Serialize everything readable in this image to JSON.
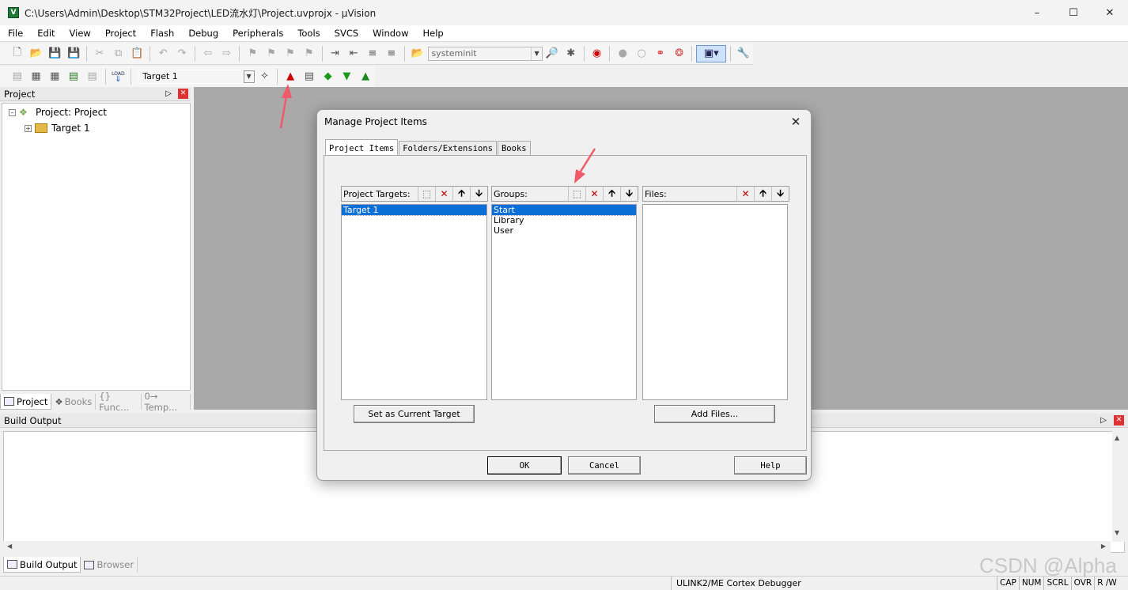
{
  "window": {
    "title": "C:\\Users\\Admin\\Desktop\\STM32Project\\LED流水灯\\Project.uvprojx - µVision",
    "app_icon": "V"
  },
  "menu": [
    "File",
    "Edit",
    "View",
    "Project",
    "Flash",
    "Debug",
    "Peripherals",
    "Tools",
    "SVCS",
    "Window",
    "Help"
  ],
  "toolbar": {
    "function_combo": "systeminit",
    "target_combo": "Target 1",
    "load_label": "LOAD"
  },
  "project_panel": {
    "title": "Project",
    "tree": {
      "root": "Project: Project",
      "child": "Target 1"
    },
    "tabs": [
      "Project",
      "Books",
      "{} Func...",
      "0→ Temp..."
    ]
  },
  "build_output": {
    "title": "Build Output",
    "tabs": [
      "Build Output",
      "Browser"
    ]
  },
  "status": {
    "debugger": "ULINK2/ME Cortex Debugger",
    "flags": [
      "CAP",
      "NUM",
      "SCRL",
      "OVR",
      "R /W"
    ]
  },
  "watermark": "CSDN @Alpha",
  "dialog": {
    "title": "Manage Project Items",
    "tabs": [
      "Project Items",
      "Folders/Extensions",
      "Books"
    ],
    "targets": {
      "label": "Project Targets:",
      "items": [
        "Target 1"
      ]
    },
    "groups": {
      "label": "Groups:",
      "items": [
        "Start",
        "Library",
        "User"
      ]
    },
    "files": {
      "label": "Files:"
    },
    "set_current_label": "Set as Current Target",
    "add_files_label": "Add Files...",
    "ok_label": "OK",
    "cancel_label": "Cancel",
    "help_label": "Help"
  },
  "colors": {
    "selection": "#0a6fd6",
    "workspace_gray": "#a9a9a9",
    "arrow_red": "#f05a68"
  }
}
